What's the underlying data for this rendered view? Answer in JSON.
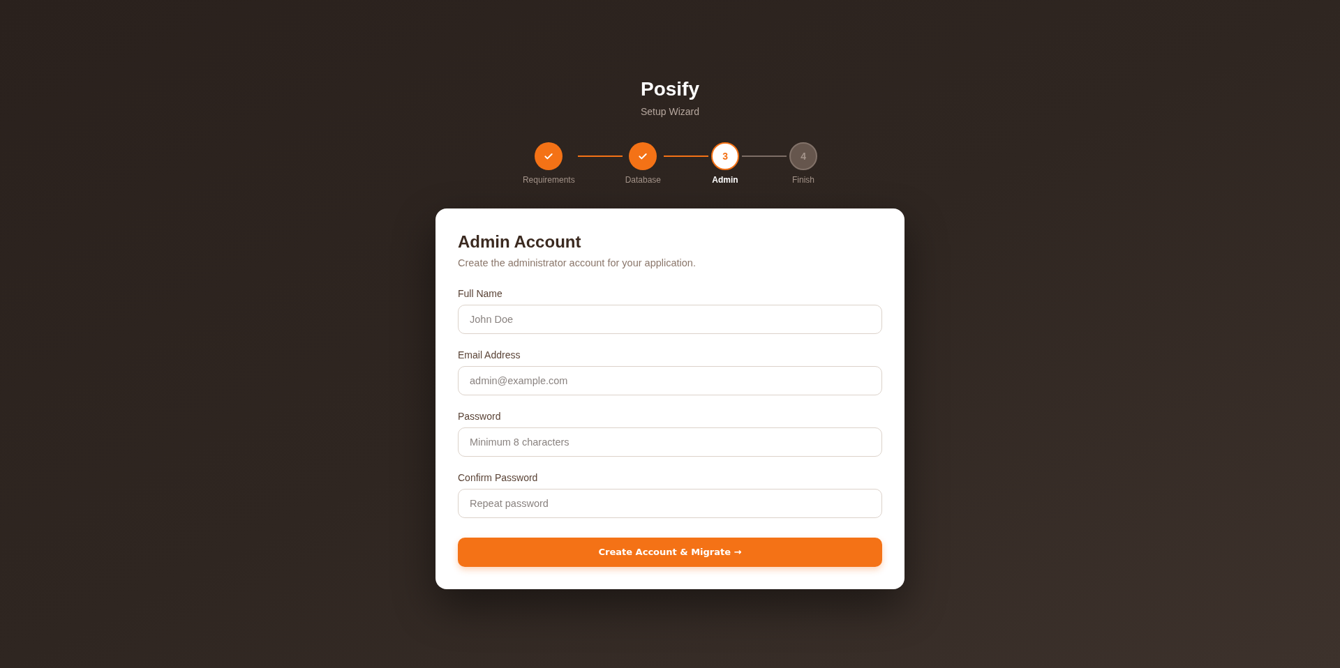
{
  "app": {
    "title": "Posify",
    "subtitle": "Setup Wizard"
  },
  "steps": [
    {
      "label": "Requirements",
      "completed": true,
      "selected": false
    },
    {
      "label": "Database",
      "completed": true,
      "selected": false
    },
    {
      "label": "Admin",
      "number": "3",
      "completed": false,
      "selected": true
    },
    {
      "label": "Finish",
      "number": "4",
      "completed": false,
      "selected": false
    }
  ],
  "card": {
    "title": "Admin Account",
    "description": "Create the administrator account for your application.",
    "fields": [
      {
        "label": "Full Name",
        "placeholder": "John Doe"
      },
      {
        "label": "Email Address",
        "placeholder": "admin@example.com"
      },
      {
        "label": "Password",
        "placeholder": "Minimum 8 characters"
      },
      {
        "label": "Confirm Password",
        "placeholder": "Repeat password"
      }
    ],
    "submit_button": "Create Account & Migrate →"
  }
}
